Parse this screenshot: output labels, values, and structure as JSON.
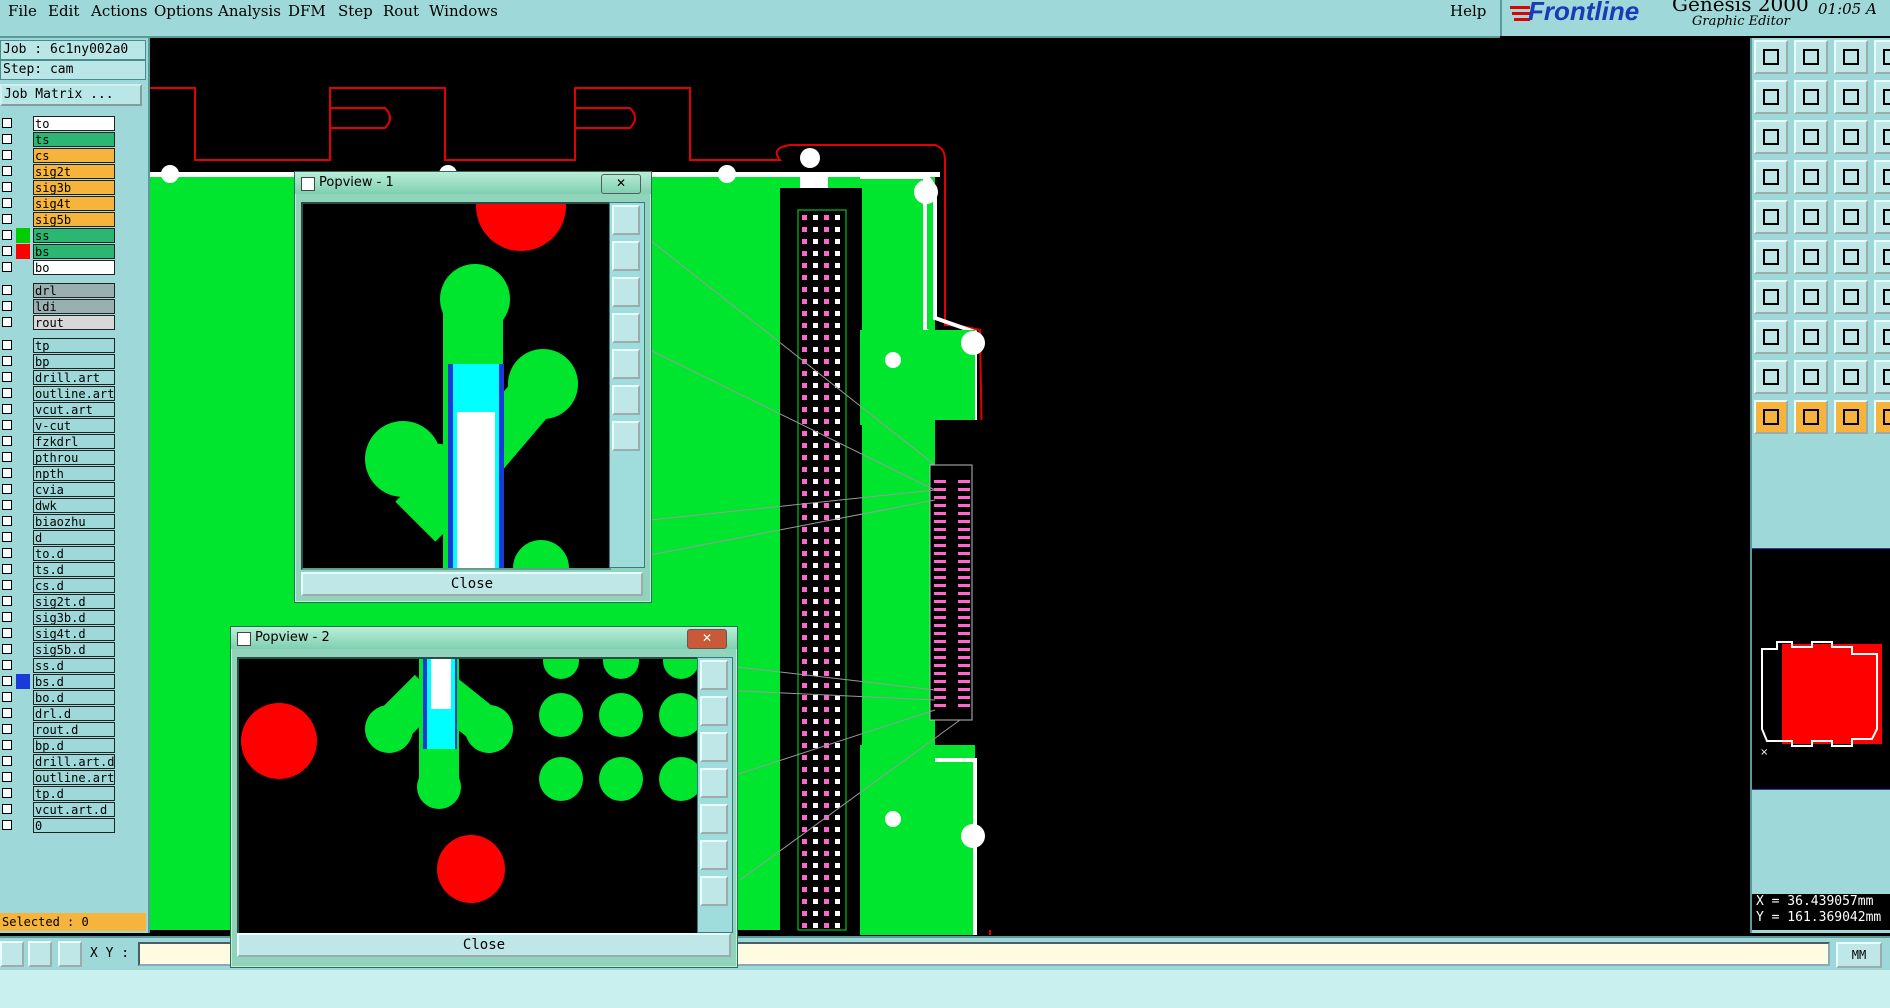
{
  "menubar": {
    "items": [
      "File",
      "Edit",
      "Actions",
      "Options",
      "Analysis",
      "DFM",
      "Step",
      "Rout",
      "Windows"
    ],
    "help": "Help"
  },
  "brand": {
    "logo": "Frontline",
    "product": "Genesis 2000",
    "subtitle": "Graphic Editor",
    "time": "01:05 A"
  },
  "left_panel": {
    "job": "Job : 6c1ny002a0",
    "step": "Step: cam",
    "job_matrix": "Job Matrix ...",
    "layers": [
      {
        "name": "to",
        "color": "#ffffff",
        "swatch": ""
      },
      {
        "name": "ts",
        "color": "#2bb673",
        "swatch": ""
      },
      {
        "name": "cs",
        "color": "#f6b43c",
        "swatch": ""
      },
      {
        "name": "sig2t",
        "color": "#f6b43c",
        "swatch": ""
      },
      {
        "name": "sig3b",
        "color": "#f6b43c",
        "swatch": ""
      },
      {
        "name": "sig4t",
        "color": "#f6b43c",
        "swatch": ""
      },
      {
        "name": "sig5b",
        "color": "#f6b43c",
        "swatch": ""
      },
      {
        "name": "ss",
        "color": "#2bb673",
        "swatch": "#00cc00"
      },
      {
        "name": "bs",
        "color": "#2bb673",
        "swatch": "#ff0000"
      },
      {
        "name": "bo",
        "color": "#ffffff",
        "swatch": ""
      },
      {
        "name": "drl",
        "color": "#9ab0b0",
        "swatch": ""
      },
      {
        "name": "ldi",
        "color": "#9ab0b0",
        "swatch": ""
      },
      {
        "name": "rout",
        "color": "#d8d8d8",
        "swatch": ""
      },
      {
        "name": "tp",
        "color": "#9fd8d8",
        "swatch": ""
      },
      {
        "name": "bp",
        "color": "#9fd8d8",
        "swatch": ""
      },
      {
        "name": "drill.art",
        "color": "#9fd8d8",
        "swatch": ""
      },
      {
        "name": "outline.art",
        "color": "#9fd8d8",
        "swatch": ""
      },
      {
        "name": "vcut.art",
        "color": "#9fd8d8",
        "swatch": ""
      },
      {
        "name": "v-cut",
        "color": "#9fd8d8",
        "swatch": ""
      },
      {
        "name": "fzkdrl",
        "color": "#9fd8d8",
        "swatch": ""
      },
      {
        "name": "pthrou",
        "color": "#9fd8d8",
        "swatch": ""
      },
      {
        "name": "npth",
        "color": "#9fd8d8",
        "swatch": ""
      },
      {
        "name": "cvia",
        "color": "#9fd8d8",
        "swatch": ""
      },
      {
        "name": "dwk",
        "color": "#9fd8d8",
        "swatch": ""
      },
      {
        "name": "biaozhu",
        "color": "#9fd8d8",
        "swatch": ""
      },
      {
        "name": "d",
        "color": "#9fd8d8",
        "swatch": ""
      },
      {
        "name": "to.d",
        "color": "#9fd8d8",
        "swatch": ""
      },
      {
        "name": "ts.d",
        "color": "#9fd8d8",
        "swatch": ""
      },
      {
        "name": "cs.d",
        "color": "#9fd8d8",
        "swatch": ""
      },
      {
        "name": "sig2t.d",
        "color": "#9fd8d8",
        "swatch": ""
      },
      {
        "name": "sig3b.d",
        "color": "#9fd8d8",
        "swatch": ""
      },
      {
        "name": "sig4t.d",
        "color": "#9fd8d8",
        "swatch": ""
      },
      {
        "name": "sig5b.d",
        "color": "#9fd8d8",
        "swatch": ""
      },
      {
        "name": "ss.d",
        "color": "#9fd8d8",
        "swatch": ""
      },
      {
        "name": "bs.d",
        "color": "#9fd8d8",
        "swatch": "#1a3bd8"
      },
      {
        "name": "bo.d",
        "color": "#9fd8d8",
        "swatch": ""
      },
      {
        "name": "drl.d",
        "color": "#9fd8d8",
        "swatch": ""
      },
      {
        "name": "rout.d",
        "color": "#9fd8d8",
        "swatch": ""
      },
      {
        "name": "bp.d",
        "color": "#9fd8d8",
        "swatch": ""
      },
      {
        "name": "drill.art.d",
        "color": "#9fd8d8",
        "swatch": ""
      },
      {
        "name": "outline.art",
        "color": "#9fd8d8",
        "swatch": ""
      },
      {
        "name": "tp.d",
        "color": "#9fd8d8",
        "swatch": ""
      },
      {
        "name": "vcut.art.d",
        "color": "#9fd8d8",
        "swatch": ""
      },
      {
        "name": "0",
        "color": "#9fd8d8",
        "swatch": ""
      }
    ],
    "selected": "Selected : 0"
  },
  "coords": {
    "x": "X = 36.439057mm",
    "y": "Y = 161.369042mm"
  },
  "bottom_bar": {
    "xy_label": "X Y :",
    "xy_value": "",
    "units": "MM"
  },
  "popview1": {
    "title": "Popview - 1",
    "close": "Close"
  },
  "popview2": {
    "title": "Popview - 2",
    "close": "Close"
  },
  "colors": {
    "panel": "#9fd8d8",
    "board": "#00e62e",
    "trace": "#ffffff",
    "pad_red": "#ff0000",
    "outline": "#e30000"
  }
}
